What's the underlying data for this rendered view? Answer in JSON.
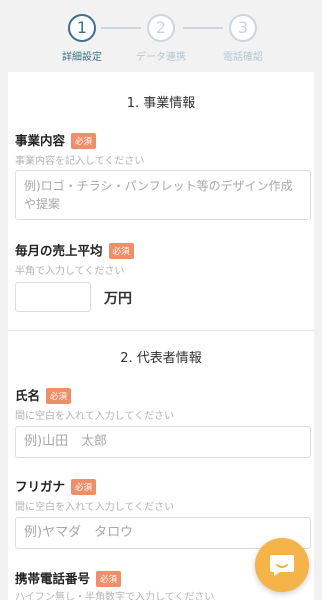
{
  "stepper": {
    "steps": [
      {
        "number": "1",
        "label": "詳細設定"
      },
      {
        "number": "2",
        "label": "データ連携"
      },
      {
        "number": "3",
        "label": "電話確認"
      }
    ],
    "active_index": 1
  },
  "section1": {
    "title": "1. 事業情報",
    "business": {
      "label": "事業内容",
      "badge": "必須",
      "hint": "事業内容を記入してください",
      "placeholder": "例)ロゴ・チラシ・パンフレット等のデザイン作成や提案"
    },
    "sales": {
      "label": "毎月の売上平均",
      "badge": "必須",
      "hint": "半角で入力してください",
      "value": "",
      "unit": "万円"
    }
  },
  "section2": {
    "title": "2. 代表者情報",
    "name": {
      "label": "氏名",
      "badge": "必須",
      "hint": "間に空白を入れて入力してください",
      "placeholder": "例)山田　太郎"
    },
    "furigana": {
      "label": "フリガナ",
      "badge": "必須",
      "hint": "間に空白を入れて入力してください",
      "placeholder": "例)ヤマダ　タロウ"
    },
    "phone": {
      "label": "携帯電話番号",
      "badge": "必須",
      "hint": "ハイフン無し・半角数字で入力してください"
    }
  },
  "colors": {
    "accent": "#3b6f8c",
    "badge": "#ef8f6a",
    "chat": "#f4b44a"
  },
  "icons": {
    "chat": "chat-bubble-icon"
  }
}
